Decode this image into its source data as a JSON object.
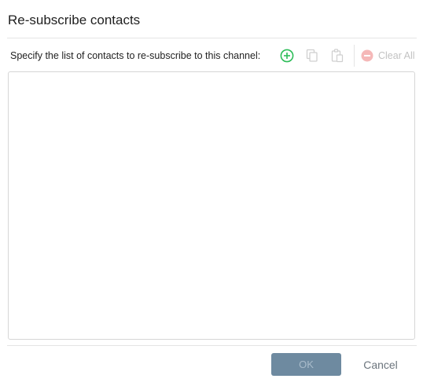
{
  "dialog": {
    "title": "Re-subscribe contacts",
    "instruction": "Specify the list of contacts to re-subscribe to this channel:",
    "toolbar": {
      "add_icon": "plus-circle-icon",
      "copy_icon": "copy-icon",
      "paste_icon": "paste-icon",
      "clear_icon": "minus-circle-icon",
      "clear_all_label": "Clear All"
    },
    "contacts_value": "",
    "footer": {
      "ok_label": "OK",
      "cancel_label": "Cancel"
    },
    "colors": {
      "add_icon": "#2ebd59",
      "disabled": "#c2c2c2",
      "ok_bg": "#6e8aa0",
      "ok_text": "#a9bccb",
      "cancel_text": "#6c757d"
    }
  }
}
